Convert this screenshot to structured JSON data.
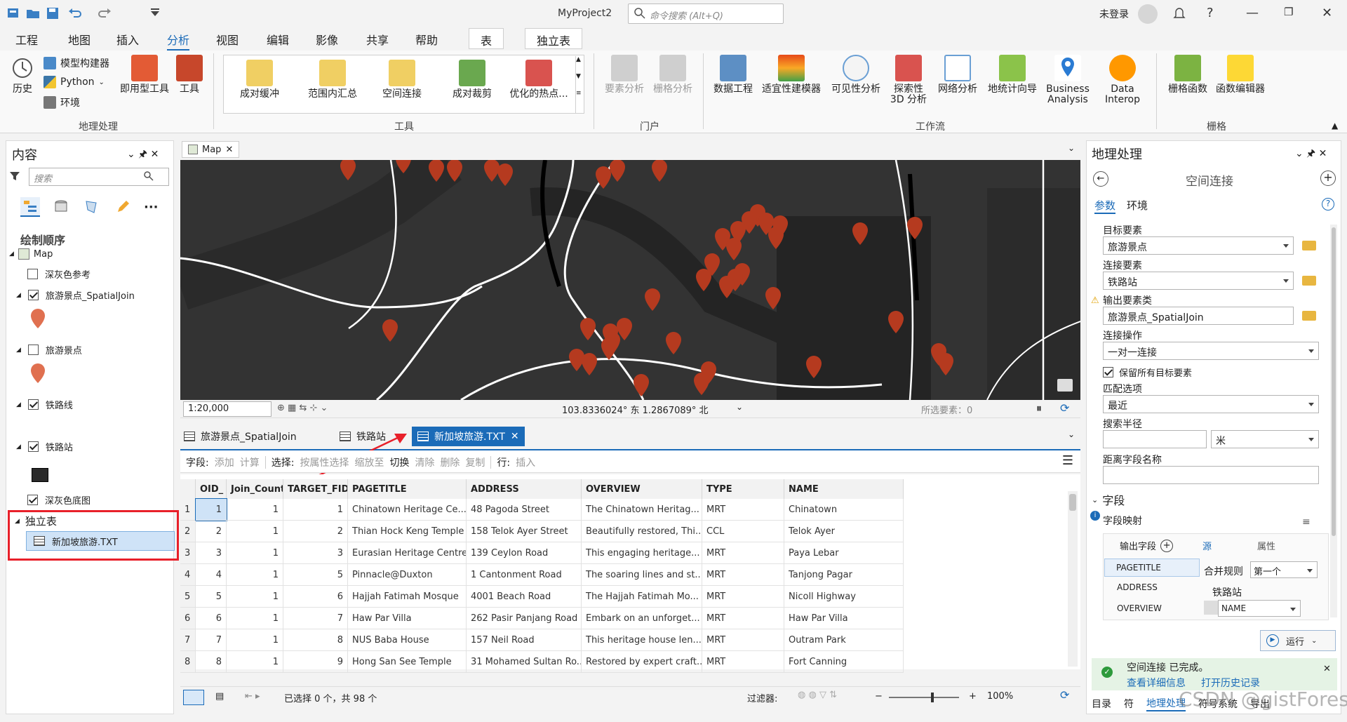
{
  "window": {
    "project": "MyProject2",
    "command_search_placeholder": "命令搜索 (Alt+Q)",
    "login": "未登录"
  },
  "menu": {
    "items": [
      "工程",
      "地图",
      "插入",
      "分析",
      "视图",
      "编辑",
      "影像",
      "共享",
      "帮助"
    ],
    "active": "分析",
    "context_tabs": [
      "表",
      "独立表"
    ]
  },
  "ribbon": {
    "geoprocessing": {
      "history": "历史",
      "model_builder": "模型构建器",
      "python": "Python",
      "environments": "环境",
      "ready_tools": "即用型工具",
      "tools": "工具",
      "label": "地理处理"
    },
    "tools": {
      "items": [
        "成对缓冲",
        "范围内汇总",
        "空间连接",
        "成对裁剪",
        "优化的热点..."
      ],
      "label": "工具"
    },
    "portal": {
      "feature_analysis": "要素分析",
      "raster_analysis": "栅格分析",
      "label": "门户"
    },
    "workflows": {
      "data_engineering": "数据工程",
      "suitability_modeler": "适宜性建模器",
      "visibility_analysis": "可见性分析",
      "exploratory_3d_line1": "探索性",
      "exploratory_3d_line2": "3D 分析",
      "network_analysis": "网络分析",
      "geostatistical_wizard": "地统计向导",
      "business_analysis_line1": "Business",
      "business_analysis_line2": "Analysis",
      "data_interop_line1": "Data",
      "data_interop_line2": "Interop",
      "label": "工作流"
    },
    "raster": {
      "raster_functions": "栅格函数",
      "function_editor": "函数编辑器",
      "label": "栅格"
    }
  },
  "contents": {
    "title": "内容",
    "search_placeholder": "搜索",
    "drawing_order": "绘制顺序",
    "map": "Map",
    "layers": [
      {
        "name": "深灰色参考",
        "checked": false
      },
      {
        "name": "旅游景点_SpatialJoin",
        "checked": true
      },
      {
        "name": "旅游景点",
        "checked": false
      },
      {
        "name": "铁路线",
        "checked": true
      },
      {
        "name": "铁路站",
        "checked": true
      },
      {
        "name": "深灰色底图",
        "checked": true
      }
    ],
    "standalone_tables": "独立表",
    "table_item": "新加坡旅游.TXT"
  },
  "map_view": {
    "tab": "Map",
    "scale": "1:20,000",
    "coords": "103.8336024° 东 1.2867089° 北",
    "selected_features": "所选要素：0"
  },
  "table_view": {
    "tabs": [
      "旅游景点_SpatialJoin",
      "铁路站",
      "新加坡旅游.TXT"
    ],
    "active_tab": "新加坡旅游.TXT",
    "toolbar": {
      "field": "字段:",
      "add": "添加",
      "calculate": "计算",
      "selection": "选择:",
      "select_by_attr": "按属性选择",
      "zoom_to": "缩放至",
      "switch": "切换",
      "clear": "清除",
      "delete": "删除",
      "copy": "复制",
      "rows": "行:",
      "insert": "插入"
    },
    "columns": [
      "OID_",
      "Join_Count",
      "TARGET_FID",
      "PAGETITLE",
      "ADDRESS",
      "OVERVIEW",
      "TYPE",
      "NAME"
    ],
    "rows": [
      [
        "1",
        "1",
        "1",
        "1",
        "Chinatown Heritage Ce...",
        "48 Pagoda Street",
        "The Chinatown Heritag...",
        "MRT",
        "Chinatown"
      ],
      [
        "2",
        "2",
        "1",
        "2",
        "Thian Hock Keng Temple",
        "158 Telok Ayer Street",
        "Beautifully restored, Thi...",
        "CCL",
        "Telok Ayer"
      ],
      [
        "3",
        "3",
        "1",
        "3",
        "Eurasian Heritage Centre",
        "139 Ceylon Road",
        "This engaging heritage...",
        "MRT",
        "Paya Lebar"
      ],
      [
        "4",
        "4",
        "1",
        "5",
        "Pinnacle@Duxton",
        "1 Cantonment Road",
        "The soaring lines and st...",
        "MRT",
        "Tanjong Pagar"
      ],
      [
        "5",
        "5",
        "1",
        "6",
        "Hajjah Fatimah Mosque",
        "4001 Beach Road",
        "The Hajjah Fatimah Mo...",
        "MRT",
        "Nicoll Highway"
      ],
      [
        "6",
        "6",
        "1",
        "7",
        "Haw Par Villa",
        "262 Pasir Panjang Road",
        "Embark on an unforget...",
        "MRT",
        "Haw Par Villa"
      ],
      [
        "7",
        "7",
        "1",
        "8",
        "NUS Baba House",
        "157 Neil Road",
        "This heritage house len...",
        "MRT",
        "Outram Park"
      ],
      [
        "8",
        "8",
        "1",
        "9",
        "Hong San See Temple",
        "31 Mohamed Sultan Ro...",
        "Restored by expert craft...",
        "MRT",
        "Fort Canning"
      ]
    ],
    "status": "已选择 0 个，共 98 个",
    "filter": "过滤器:",
    "zoom": "100%"
  },
  "geoprocessing": {
    "title": "地理处理",
    "tool": "空间连接",
    "tab_params": "参数",
    "tab_env": "环境",
    "target_label": "目标要素",
    "target_value": "旅游景点",
    "join_label": "连接要素",
    "join_value": "铁路站",
    "output_label": "输出要素类",
    "output_value": "旅游景点_SpatialJoin",
    "operation_label": "连接操作",
    "operation_value": "一对一连接",
    "keep_all": "保留所有目标要素",
    "match_label": "匹配选项",
    "match_value": "最近",
    "radius_label": "搜索半径",
    "radius_unit": "米",
    "distance_field_label": "距离字段名称",
    "fields_section": "字段",
    "field_map": "字段映射",
    "output_fields": "输出字段",
    "source_tab": "源",
    "property_tab": "属性",
    "field_list": [
      "PAGETITLE",
      "ADDRESS",
      "OVERVIEW"
    ],
    "merge_rule_label": "合并规则",
    "merge_rule_value": "第一个",
    "source_layer": "铁路站",
    "source_field": "NAME",
    "run": "运行",
    "completed": "空间连接 已完成。",
    "view_details": "查看详细信息",
    "open_history": "打开历史记录",
    "bottom_tabs": [
      "目录",
      "符",
      "地理处理",
      "符号系统",
      "导出"
    ]
  },
  "watermark": "CSDN @gistForest_L",
  "colors": {
    "accent": "#1b6bb8",
    "highlight_red": "#e8202a",
    "pin": "#b53a1f",
    "map_bg": "#323232"
  }
}
